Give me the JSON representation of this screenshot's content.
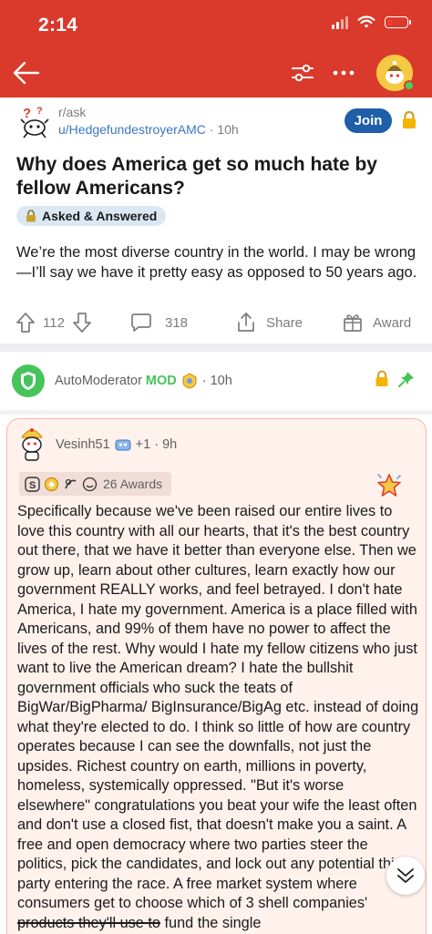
{
  "status_bar": {
    "time": "2:14"
  },
  "header": {
    "back_icon": "arrow-left-icon",
    "sort_icon": "sliders-icon",
    "more_icon": "more-horizontal-icon",
    "avatar_icon": "user-avatar",
    "colors": {
      "background": "#d93a2b"
    }
  },
  "post": {
    "subreddit": "r/ask",
    "author": "u/HedgefundestroyerAMC",
    "age": "10h",
    "join_label": "Join",
    "title": "Why does America get so much hate by fellow Americans?",
    "flair": "Asked & Answered",
    "body": "We’re the most diverse country in the world.  I may be wrong—I’ll say we have it pretty easy as opposed to 50 years ago.",
    "votes": "112",
    "comments": "318",
    "share_label": "Share",
    "award_label": "Award"
  },
  "automod": {
    "name": "AutoModerator",
    "tag": "MOD",
    "age": "10h"
  },
  "comment": {
    "author": "Vesinh51",
    "plus": "+1",
    "age": "9h",
    "awards": "26 Awards",
    "body_main": "Specifically because we've been raised our entire lives to love this country with all our hearts, that it's the best country out there, that we have it better than everyone else. Then we grow up, learn about other cultures, learn exactly how our government REALLY works, and feel betrayed. I don't hate America, I hate my government. America is a place filled with Americans, and 99% of them have no power to affect the lives of the rest. Why would I hate my fellow citizens who just want to live the American dream? I hate the bullshit government officials who suck the teats of BigWar/BigPharma/ BigInsurance/BigAg etc. instead of doing what they're elected to do. I think so little of how are country operates because I can see the downfalls, not just the upsides. Richest country on earth, millions in poverty, homeless, systemically oppressed. \"But it's worse elsewhere\" congratulations you beat your wife the least often and don't use a closed fist, that doesn't make you a saint. A free and open democracy where two parties steer the politics, pick the candidates, and lock out any potential third party entering the race. A free market system where consumers get to choose which of 3 shell companies' ",
    "body_strike": "products they'll use to",
    "body_end": " fund the single"
  }
}
